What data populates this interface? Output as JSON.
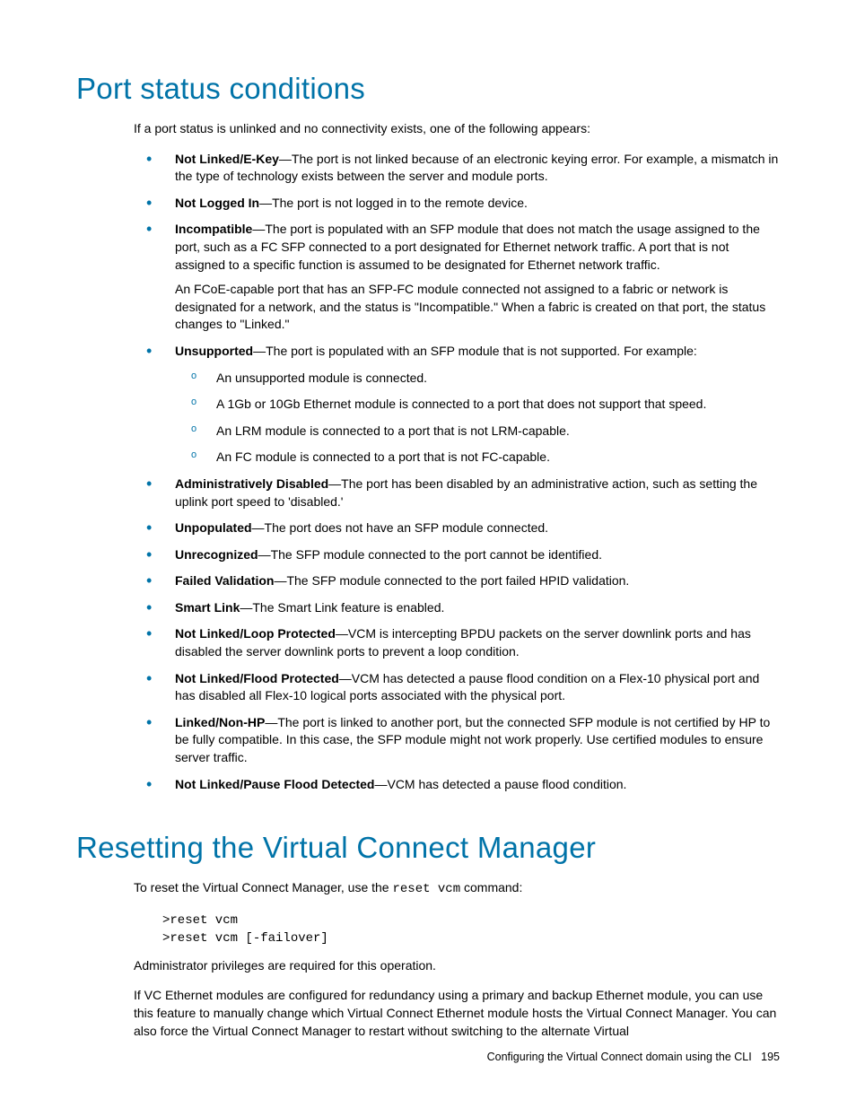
{
  "section1": {
    "heading": "Port status conditions",
    "intro": "If a port status is unlinked and no connectivity exists, one of the following appears:",
    "items": [
      {
        "term": "Not Linked/E-Key",
        "desc": "—The port is not linked because of an electronic keying error. For example, a mismatch in the type of technology exists between the server and module ports."
      },
      {
        "term": "Not Logged In",
        "desc": "—The port is not logged in to the remote device."
      },
      {
        "term": "Incompatible",
        "desc": "—The port is populated with an SFP module that does not match the usage assigned to the port, such as a FC SFP connected to a port designated for Ethernet network traffic. A port that is not assigned to a specific function is assumed to be designated for Ethernet network traffic.",
        "extra": "An FCoE-capable port that has an SFP-FC module connected not assigned to a fabric or network is designated for a network, and the status is \"Incompatible.\" When a fabric is created on that port, the status changes to \"Linked.\""
      },
      {
        "term": "Unsupported",
        "desc": "—The port is populated with an SFP module that is not supported. For example:",
        "sub": [
          "An unsupported module is connected.",
          "A 1Gb or 10Gb Ethernet module is connected to a port that does not support that speed.",
          "An LRM module is connected to a port that is not LRM-capable.",
          "An FC module is connected to a port that is not FC-capable."
        ]
      },
      {
        "term": "Administratively Disabled",
        "desc": "—The port has been disabled by an administrative action, such as setting the uplink port speed to 'disabled.'"
      },
      {
        "term": "Unpopulated",
        "desc": "—The port does not have an SFP module connected."
      },
      {
        "term": "Unrecognized",
        "desc": "—The SFP module connected to the port cannot be identified."
      },
      {
        "term": "Failed Validation",
        "desc": "—The SFP module connected to the port failed HPID validation."
      },
      {
        "term": "Smart Link",
        "desc": "—The Smart Link feature is enabled."
      },
      {
        "term": "Not Linked/Loop Protected",
        "desc": "—VCM is intercepting BPDU packets on the server downlink ports and has disabled the server downlink ports to prevent a loop condition."
      },
      {
        "term": "Not Linked/Flood Protected",
        "desc": "—VCM has detected a pause flood condition on a Flex-10 physical port and has disabled all Flex-10 logical ports associated with the physical port."
      },
      {
        "term": "Linked/Non-HP",
        "desc": "—The port is linked to another port, but the connected SFP module is not certified by HP to be fully compatible. In this case, the SFP module might not work properly. Use certified modules to ensure server traffic."
      },
      {
        "term": "Not Linked/Pause Flood Detected",
        "desc": "—VCM has detected a pause flood condition."
      }
    ]
  },
  "section2": {
    "heading": "Resetting the Virtual Connect Manager",
    "intro_pre": "To reset the Virtual Connect Manager, use the ",
    "intro_code": "reset vcm",
    "intro_post": " command:",
    "code": ">reset vcm\n>reset vcm [-failover]",
    "para1": "Administrator privileges are required for this operation.",
    "para2": "If VC Ethernet modules are configured for redundancy using a primary and backup Ethernet module, you can use this feature to manually change which Virtual Connect Ethernet module hosts the Virtual Connect Manager. You can also force the Virtual Connect Manager to restart without switching to the alternate Virtual"
  },
  "footer": {
    "text": "Configuring the Virtual Connect domain using the CLI",
    "page": "195"
  }
}
